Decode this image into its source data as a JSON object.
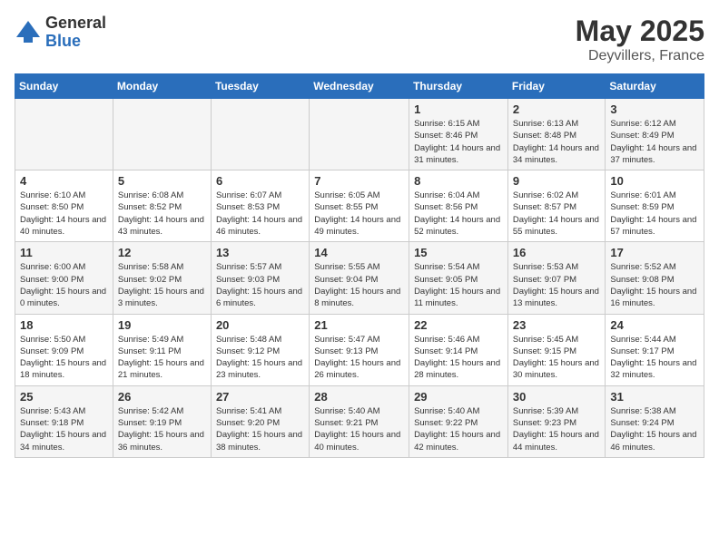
{
  "header": {
    "logo_general": "General",
    "logo_blue": "Blue",
    "month": "May 2025",
    "location": "Deyvillers, France"
  },
  "days_of_week": [
    "Sunday",
    "Monday",
    "Tuesday",
    "Wednesday",
    "Thursday",
    "Friday",
    "Saturday"
  ],
  "weeks": [
    [
      {
        "day": "",
        "info": ""
      },
      {
        "day": "",
        "info": ""
      },
      {
        "day": "",
        "info": ""
      },
      {
        "day": "",
        "info": ""
      },
      {
        "day": "1",
        "info": "Sunrise: 6:15 AM\nSunset: 8:46 PM\nDaylight: 14 hours and 31 minutes."
      },
      {
        "day": "2",
        "info": "Sunrise: 6:13 AM\nSunset: 8:48 PM\nDaylight: 14 hours and 34 minutes."
      },
      {
        "day": "3",
        "info": "Sunrise: 6:12 AM\nSunset: 8:49 PM\nDaylight: 14 hours and 37 minutes."
      }
    ],
    [
      {
        "day": "4",
        "info": "Sunrise: 6:10 AM\nSunset: 8:50 PM\nDaylight: 14 hours and 40 minutes."
      },
      {
        "day": "5",
        "info": "Sunrise: 6:08 AM\nSunset: 8:52 PM\nDaylight: 14 hours and 43 minutes."
      },
      {
        "day": "6",
        "info": "Sunrise: 6:07 AM\nSunset: 8:53 PM\nDaylight: 14 hours and 46 minutes."
      },
      {
        "day": "7",
        "info": "Sunrise: 6:05 AM\nSunset: 8:55 PM\nDaylight: 14 hours and 49 minutes."
      },
      {
        "day": "8",
        "info": "Sunrise: 6:04 AM\nSunset: 8:56 PM\nDaylight: 14 hours and 52 minutes."
      },
      {
        "day": "9",
        "info": "Sunrise: 6:02 AM\nSunset: 8:57 PM\nDaylight: 14 hours and 55 minutes."
      },
      {
        "day": "10",
        "info": "Sunrise: 6:01 AM\nSunset: 8:59 PM\nDaylight: 14 hours and 57 minutes."
      }
    ],
    [
      {
        "day": "11",
        "info": "Sunrise: 6:00 AM\nSunset: 9:00 PM\nDaylight: 15 hours and 0 minutes."
      },
      {
        "day": "12",
        "info": "Sunrise: 5:58 AM\nSunset: 9:02 PM\nDaylight: 15 hours and 3 minutes."
      },
      {
        "day": "13",
        "info": "Sunrise: 5:57 AM\nSunset: 9:03 PM\nDaylight: 15 hours and 6 minutes."
      },
      {
        "day": "14",
        "info": "Sunrise: 5:55 AM\nSunset: 9:04 PM\nDaylight: 15 hours and 8 minutes."
      },
      {
        "day": "15",
        "info": "Sunrise: 5:54 AM\nSunset: 9:05 PM\nDaylight: 15 hours and 11 minutes."
      },
      {
        "day": "16",
        "info": "Sunrise: 5:53 AM\nSunset: 9:07 PM\nDaylight: 15 hours and 13 minutes."
      },
      {
        "day": "17",
        "info": "Sunrise: 5:52 AM\nSunset: 9:08 PM\nDaylight: 15 hours and 16 minutes."
      }
    ],
    [
      {
        "day": "18",
        "info": "Sunrise: 5:50 AM\nSunset: 9:09 PM\nDaylight: 15 hours and 18 minutes."
      },
      {
        "day": "19",
        "info": "Sunrise: 5:49 AM\nSunset: 9:11 PM\nDaylight: 15 hours and 21 minutes."
      },
      {
        "day": "20",
        "info": "Sunrise: 5:48 AM\nSunset: 9:12 PM\nDaylight: 15 hours and 23 minutes."
      },
      {
        "day": "21",
        "info": "Sunrise: 5:47 AM\nSunset: 9:13 PM\nDaylight: 15 hours and 26 minutes."
      },
      {
        "day": "22",
        "info": "Sunrise: 5:46 AM\nSunset: 9:14 PM\nDaylight: 15 hours and 28 minutes."
      },
      {
        "day": "23",
        "info": "Sunrise: 5:45 AM\nSunset: 9:15 PM\nDaylight: 15 hours and 30 minutes."
      },
      {
        "day": "24",
        "info": "Sunrise: 5:44 AM\nSunset: 9:17 PM\nDaylight: 15 hours and 32 minutes."
      }
    ],
    [
      {
        "day": "25",
        "info": "Sunrise: 5:43 AM\nSunset: 9:18 PM\nDaylight: 15 hours and 34 minutes."
      },
      {
        "day": "26",
        "info": "Sunrise: 5:42 AM\nSunset: 9:19 PM\nDaylight: 15 hours and 36 minutes."
      },
      {
        "day": "27",
        "info": "Sunrise: 5:41 AM\nSunset: 9:20 PM\nDaylight: 15 hours and 38 minutes."
      },
      {
        "day": "28",
        "info": "Sunrise: 5:40 AM\nSunset: 9:21 PM\nDaylight: 15 hours and 40 minutes."
      },
      {
        "day": "29",
        "info": "Sunrise: 5:40 AM\nSunset: 9:22 PM\nDaylight: 15 hours and 42 minutes."
      },
      {
        "day": "30",
        "info": "Sunrise: 5:39 AM\nSunset: 9:23 PM\nDaylight: 15 hours and 44 minutes."
      },
      {
        "day": "31",
        "info": "Sunrise: 5:38 AM\nSunset: 9:24 PM\nDaylight: 15 hours and 46 minutes."
      }
    ]
  ]
}
